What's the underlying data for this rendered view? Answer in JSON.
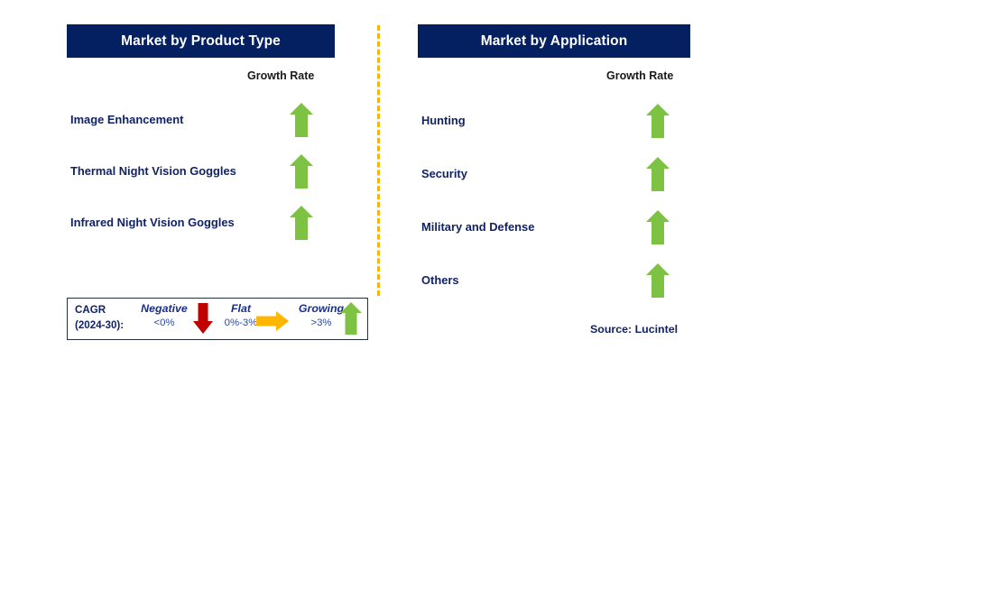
{
  "panels": [
    {
      "id": "product-type",
      "title": "Market by Product Type",
      "growth_caption": "Growth Rate",
      "rows": [
        {
          "label": "Image Enhancement",
          "trend": "growing",
          "trend_icon": "arrow-up-icon"
        },
        {
          "label": "Thermal Night Vision Goggles",
          "trend": "growing",
          "trend_icon": "arrow-up-icon"
        },
        {
          "label": "Infrared Night Vision Goggles",
          "trend": "growing",
          "trend_icon": "arrow-up-icon"
        }
      ]
    },
    {
      "id": "application",
      "title": "Market by Application",
      "growth_caption": "Growth Rate",
      "rows": [
        {
          "label": "Hunting",
          "trend": "growing",
          "trend_icon": "arrow-up-icon"
        },
        {
          "label": "Security",
          "trend": "growing",
          "trend_icon": "arrow-up-icon"
        },
        {
          "label": "Military and Defense",
          "trend": "growing",
          "trend_icon": "arrow-up-icon"
        },
        {
          "label": "Others",
          "trend": "growing",
          "trend_icon": "arrow-up-icon"
        }
      ]
    }
  ],
  "legend": {
    "title_line1": "CAGR",
    "title_line2": "(2024-30):",
    "entries": [
      {
        "term": "Negative",
        "range": "<0%",
        "icon": "arrow-down-icon",
        "color": "#C00000"
      },
      {
        "term": "Flat",
        "range": "0%-3%",
        "icon": "arrow-right-icon",
        "color": "#FFB600"
      },
      {
        "term": "Growing",
        "range": ">3%",
        "icon": "arrow-up-icon",
        "color": "#7DC242"
      }
    ]
  },
  "source": "Source: Lucintel",
  "colors": {
    "header_navy": "#042061",
    "label_navy": "#112266",
    "growing_green": "#7DC242",
    "negative_red": "#C00000",
    "flat_orange": "#FFB600",
    "divider_amber": "#FAB40B",
    "legend_border": "#22303f"
  }
}
